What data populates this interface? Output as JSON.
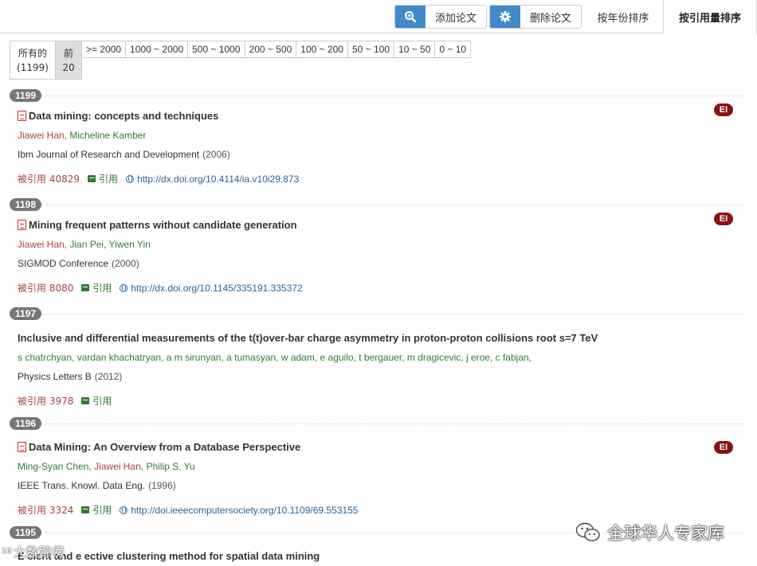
{
  "toolbar": {
    "add_paper_label": "添加论文",
    "delete_paper_label": "删除论文",
    "tab_by_year": "按年份排序",
    "tab_by_citation": "按引用量排序"
  },
  "filters": {
    "all_label": "所有的",
    "all_count": "(1199)",
    "top_label": "前",
    "top_count": "20",
    "ranges": [
      ">= 2000",
      "1000 ~ 2000",
      "500 ~ 1000",
      "200 ~ 500",
      "100 ~ 200",
      "50 ~ 100",
      "10 ~ 50",
      "0 ~ 10"
    ]
  },
  "papers": [
    {
      "rank": "1199",
      "title": "Data mining: concepts and techniques",
      "has_pdf": true,
      "ei": "EI",
      "authors": [
        {
          "name": "Jiawei Han",
          "highlight": true
        },
        {
          "name": "Micheline Kamber",
          "highlight": false
        }
      ],
      "venue": "Ibm Journal of Research and Development",
      "year": "(2006)",
      "cited": "被引用 40829",
      "cite_label": "引用",
      "doi": "http://dx.doi.org/10.4114/ia.v10i29.873"
    },
    {
      "rank": "1198",
      "title": "Mining frequent patterns without candidate generation",
      "has_pdf": true,
      "ei": "EI",
      "authors": [
        {
          "name": "Jiawei Han",
          "highlight": true
        },
        {
          "name": "Jian Pei",
          "highlight": false
        },
        {
          "name": "Yiwen Yin",
          "highlight": false
        }
      ],
      "venue": "SIGMOD Conference",
      "year": "(2000)",
      "cited": "被引用 8080",
      "cite_label": "引用",
      "doi": "http://dx.doi.org/10.1145/335191.335372"
    },
    {
      "rank": "1197",
      "title": "Inclusive and differential measurements of the t(t)over-bar charge asymmetry in proton-proton collisions root s=7 TeV",
      "has_pdf": false,
      "ei": "",
      "authors_text": "s chatrchyan, vardan khachatryan, a m sirunyan, a tumasyan, w adam, e aguilo, t bergauer, m dragicevic, j eroe, c fabjan,",
      "venue": "Physics Letters B",
      "year": "(2012)",
      "cited": "被引用 3978",
      "cite_label": "引用",
      "doi": ""
    },
    {
      "rank": "1196",
      "title": "Data Mining: An Overview from a Database Perspective",
      "has_pdf": true,
      "ei": "EI",
      "authors": [
        {
          "name": "Ming-Syan Chen",
          "highlight": false
        },
        {
          "name": "Jiawei Han",
          "highlight": true
        },
        {
          "name": "Philip S. Yu",
          "highlight": false
        }
      ],
      "venue": "IEEE Trans. Knowl. Data Eng.",
      "year": "(1996)",
      "cited": "被引用 3324",
      "cite_label": "引用",
      "doi": "http://doi.ieeecomputersociety.org/10.1109/69.553155"
    },
    {
      "rank": "1195",
      "title": "E cient and e ective clustering method for spatial data mining",
      "has_pdf": false,
      "ei": ""
    }
  ],
  "watermark": {
    "right": "全球华人专家库",
    "left_small": "10",
    "left": "大数踪傍"
  },
  "colors": {
    "accent": "#428bca",
    "badge": "#777777",
    "ei_badge": "#8b1111",
    "author_green": "#2e7d32",
    "author_highlight": "#a94442",
    "link_blue": "#2a6496"
  }
}
